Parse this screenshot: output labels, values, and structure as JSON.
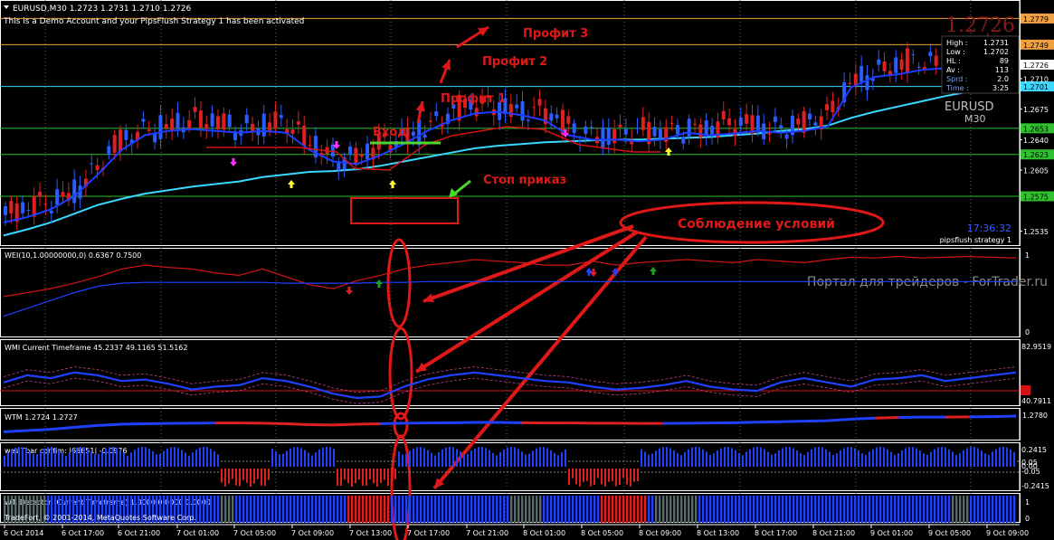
{
  "window": {
    "symbol_line": "EURUSD,M30  1.2723 1.2731 1.2710 1.2726",
    "demo_notice": "This is a Demo Account and your PipsFlush Strategy 1 has been activated",
    "big_price": "1.2726",
    "info_symbol": "EURUSD",
    "info_timeframe": "M30",
    "clock": "17:36:32",
    "strategy_label": "pipsflush strategy 1",
    "watermark": "Портал для трейдеров - ForTrader.ru",
    "copyright": "TradeFort, © 2001-2014, MetaQuotes Software Corp."
  },
  "info_panel": [
    {
      "label": "High :",
      "value": "1.2731"
    },
    {
      "label": "Low :",
      "value": "1.2702"
    },
    {
      "label": "HL :",
      "value": "89"
    },
    {
      "label": "Av :",
      "value": "113"
    },
    {
      "label": "Sprd :",
      "value": "2.0"
    },
    {
      "label": "Time :",
      "value": "3:25"
    }
  ],
  "annotations": {
    "profit3": "Профит 3",
    "profit2": "Профит 2",
    "profit1": "Профит 1",
    "entry": "Вход",
    "stop": "Стоп приказ",
    "conditions": "Соблюдение условий"
  },
  "colors": {
    "background": "#000000",
    "bull_candle": "#2b5cff",
    "bear_candle": "#e02020",
    "fast_ma": "#1e3cff",
    "slow_ma": "#38d8ff",
    "annotation": "#e01818",
    "entry_line": "#4cd630"
  },
  "chart_data": [
    {
      "type": "line",
      "name": "main",
      "title": "EURUSD,M30",
      "y_ticks": [
        "1.2726",
        "1.2710",
        "1.2675",
        "1.2640",
        "1.2605",
        "1.2535"
      ],
      "ylim": [
        1.252,
        1.2795
      ],
      "horizontal_levels": [
        {
          "value": "1.2779",
          "color": "#f0a040"
        },
        {
          "value": "1.2749",
          "color": "#f0a040"
        },
        {
          "value": "1.2701",
          "color": "#38d8ff"
        },
        {
          "value": "1.2653",
          "color": "#30c030"
        },
        {
          "value": "1.2623",
          "color": "#30c030"
        },
        {
          "value": "1.2575",
          "color": "#30c030"
        }
      ],
      "series": [
        {
          "values": [
            1.2545,
            1.2551,
            1.256,
            1.2575,
            1.26,
            1.2628,
            1.2645,
            1.265,
            1.2652,
            1.265,
            1.2648,
            1.265,
            1.2648,
            1.2628,
            1.2615,
            1.2612,
            1.2622,
            1.2635,
            1.265,
            1.2662,
            1.267,
            1.2672,
            1.2668,
            1.2662,
            1.2645,
            1.264,
            1.264,
            1.2638,
            1.264,
            1.2648,
            1.2645,
            1.2647,
            1.265,
            1.2648,
            1.265,
            1.2655,
            1.27,
            1.2712,
            1.2715,
            1.272,
            1.2722,
            1.2722,
            1.2725,
            1.2726
          ]
        },
        {
          "values": [
            1.253,
            1.2537,
            1.2545,
            1.2555,
            1.2565,
            1.2572,
            1.2578,
            1.2582,
            1.2586,
            1.2589,
            1.2592,
            1.2597,
            1.26,
            1.2603,
            1.2604,
            1.2606,
            1.261,
            1.2615,
            1.262,
            1.2625,
            1.263,
            1.2633,
            1.2635,
            1.2637,
            1.2638,
            1.2639,
            1.264,
            1.264,
            1.2641,
            1.2642,
            1.2643,
            1.2645,
            1.2647,
            1.265,
            1.2652,
            1.2656,
            1.2665,
            1.2672,
            1.2678,
            1.2684,
            1.269,
            1.2695,
            1.27,
            1.2705
          ]
        }
      ]
    },
    {
      "type": "line",
      "title": "WEI(10,1.00000000,0) 0.6367 0.7500",
      "y_ticks": [
        "1",
        "0"
      ],
      "ylim": [
        0,
        1
      ],
      "series": [
        {
          "values": [
            0.45,
            0.5,
            0.55,
            0.62,
            0.7,
            0.8,
            0.85,
            0.82,
            0.8,
            0.75,
            0.72,
            0.8,
            0.7,
            0.6,
            0.55,
            0.65,
            0.72,
            0.8,
            0.85,
            0.88,
            0.92,
            0.9,
            0.88,
            0.85,
            0.85,
            0.9,
            0.85,
            0.88,
            0.9,
            0.92,
            0.9,
            0.88,
            0.92,
            0.9,
            0.88,
            0.92,
            0.95,
            0.94,
            0.96,
            0.94,
            0.95,
            0.96,
            0.95,
            0.94
          ]
        },
        {
          "values": [
            0.2,
            0.3,
            0.4,
            0.5,
            0.58,
            0.62,
            0.63,
            0.63,
            0.63,
            0.63,
            0.63,
            0.63,
            0.62,
            0.62,
            0.62,
            0.62,
            0.63,
            0.63,
            0.64,
            0.64,
            0.64,
            0.64,
            0.64,
            0.64,
            0.64,
            0.64,
            0.64,
            0.64,
            0.64,
            0.64,
            0.64,
            0.64,
            0.64,
            0.64,
            0.64,
            0.64,
            0.64,
            0.64,
            0.64,
            0.64,
            0.64,
            0.64,
            0.64,
            0.64
          ]
        }
      ]
    },
    {
      "type": "line",
      "title": "WMI Current Timeframe 45.2337 49.1165 51.5162",
      "y_ticks": [
        "82.9519",
        "40.7911"
      ],
      "ylim": [
        40.7911,
        82.9519
      ],
      "series": [
        {
          "values": [
            55,
            60,
            58,
            62,
            60,
            56,
            57,
            54,
            50,
            52,
            53,
            58,
            56,
            52,
            47,
            44,
            45,
            52,
            57,
            60,
            62,
            60,
            58,
            56,
            55,
            52,
            50,
            51,
            53,
            56,
            52,
            50,
            49,
            55,
            58,
            55,
            52,
            57,
            58,
            60,
            56,
            58,
            60,
            62
          ]
        }
      ]
    },
    {
      "type": "line",
      "title": "WTM 1.2724 1.2727",
      "y_ticks": [
        "1.2780"
      ],
      "series": [
        {
          "values": [
            0.2,
            0.25,
            0.3,
            0.38,
            0.45,
            0.5,
            0.52,
            0.53,
            0.54,
            0.55,
            0.55,
            0.54,
            0.52,
            0.48,
            0.47,
            0.5,
            0.52,
            0.54,
            0.55,
            0.56,
            0.57,
            0.57,
            0.56,
            0.55,
            0.55,
            0.54,
            0.54,
            0.53,
            0.53,
            0.54,
            0.55,
            0.56,
            0.58,
            0.6,
            0.62,
            0.64,
            0.7,
            0.74,
            0.77,
            0.78,
            0.78,
            0.79,
            0.8,
            0.82
          ]
        }
      ]
    },
    {
      "type": "bar",
      "title": "wes Tbar confim: |65651|  -0.0976",
      "y_ticks": [
        "0.2415",
        "0.05",
        "0.00",
        "-0.05",
        "-0.2415"
      ],
      "ylim": [
        -0.2415,
        0.2415
      ]
    },
    {
      "type": "bar",
      "title": "WT. Detector (Current Timeframe) 1.0000 0.0000 0.0000",
      "y_ticks": [
        "1",
        "0"
      ],
      "ylim": [
        0,
        1
      ]
    }
  ],
  "time_axis": [
    "6 Oct 2014",
    "6 Oct 17:00",
    "6 Oct 21:00",
    "7 Oct 01:00",
    "7 Oct 05:00",
    "7 Oct 09:00",
    "7 Oct 13:00",
    "7 Oct 17:00",
    "7 Oct 21:00",
    "8 Oct 01:00",
    "8 Oct 05:00",
    "8 Oct 09:00",
    "8 Oct 13:00",
    "8 Oct 17:00",
    "8 Oct 21:00",
    "9 Oct 01:00",
    "9 Oct 05:00",
    "9 Oct 09:00"
  ]
}
